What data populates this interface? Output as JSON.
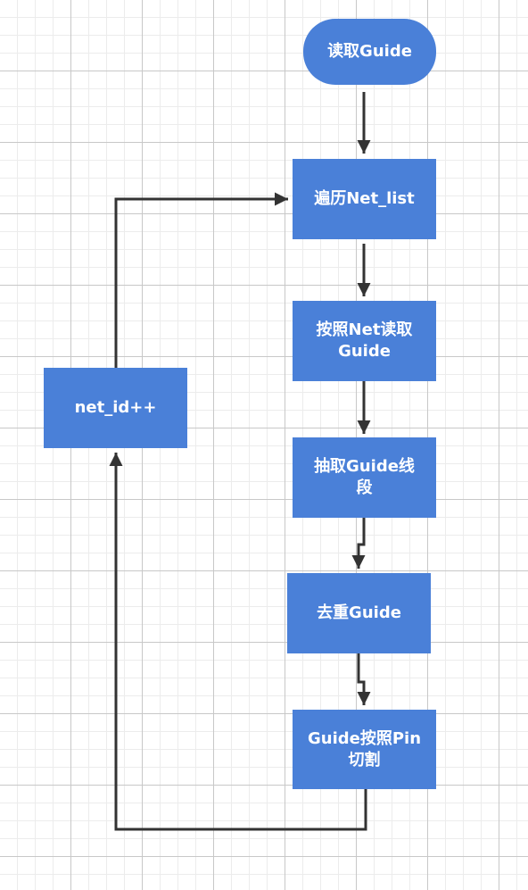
{
  "diagram": {
    "type": "flowchart",
    "colors": {
      "node_fill": "#4a80d8",
      "node_text": "#ffffff",
      "connector": "#333333",
      "background": "#ffffff",
      "grid": "#e6e6e6"
    },
    "nodes": {
      "start": "读取Guide",
      "traverse": "遍历Net_list",
      "read_by_net": "按照Net读取\nGuide",
      "extract": "抽取Guide线\n段",
      "dedupe": "去重Guide",
      "cut_by_pin": "Guide按照Pin\n切割",
      "increment": "net_id++"
    },
    "edges": [
      {
        "from": "start",
        "to": "traverse"
      },
      {
        "from": "traverse",
        "to": "read_by_net"
      },
      {
        "from": "read_by_net",
        "to": "extract"
      },
      {
        "from": "extract",
        "to": "dedupe"
      },
      {
        "from": "dedupe",
        "to": "cut_by_pin"
      },
      {
        "from": "cut_by_pin",
        "to": "increment"
      },
      {
        "from": "increment",
        "to": "traverse"
      }
    ]
  }
}
